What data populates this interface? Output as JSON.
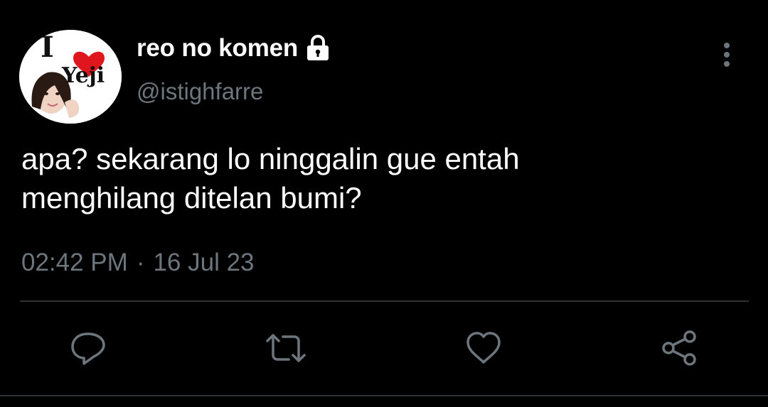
{
  "author": {
    "display_name": "reo no komen",
    "handle": "@istighfarre",
    "avatar_text_i": "I",
    "avatar_text_name": "Yeji"
  },
  "tweet": {
    "text": "apa? sekarang lo ninggalin gue entah\nmenghilang ditelan bumi?",
    "time": "02:42 PM",
    "separator": "·",
    "date": "16 Jul 23"
  },
  "icons": {
    "lock": "lock-icon",
    "more": "more-vertical-icon",
    "reply": "reply-icon",
    "retweet": "retweet-icon",
    "like": "heart-icon",
    "share": "share-icon"
  },
  "colors": {
    "background": "#000000",
    "primary_text": "#ffffff",
    "secondary_text": "#6e767d",
    "icon": "#6e767d",
    "divider": "#2f3336",
    "heart_red": "#e0161f"
  }
}
